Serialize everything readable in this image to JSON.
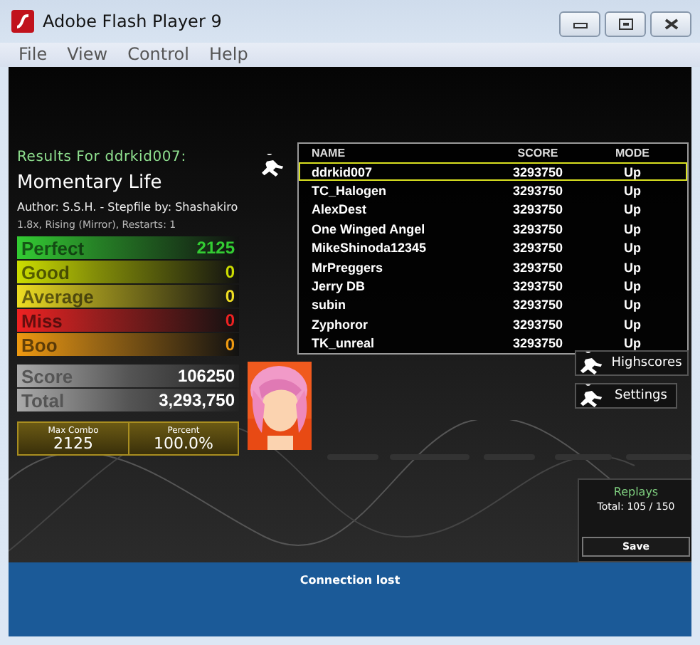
{
  "window": {
    "title": "Adobe Flash Player 9",
    "menu": [
      "File",
      "View",
      "Control",
      "Help"
    ]
  },
  "results": {
    "heading": "Results For ddrkid007:",
    "song": "Momentary Life",
    "credits": "Author: S.S.H.  -  Stepfile by: Shashakiro",
    "mods": "1.8x, Rising (Mirror), Restarts: 1",
    "judgements": [
      {
        "label": "Perfect",
        "value": "2125",
        "color": "#33cc33"
      },
      {
        "label": "Good",
        "value": "0",
        "color": "#ccdd00"
      },
      {
        "label": "Average",
        "value": "0",
        "color": "#eedd22"
      },
      {
        "label": "Miss",
        "value": "0",
        "color": "#ee2222"
      },
      {
        "label": "Boo",
        "value": "0",
        "color": "#ee9911"
      }
    ],
    "score": {
      "label": "Score",
      "value": "106250"
    },
    "total": {
      "label": "Total",
      "value": "3,293,750"
    },
    "max_combo": {
      "label": "Max Combo",
      "value": "2125"
    },
    "percent": {
      "label": "Percent",
      "value": "100.0%"
    }
  },
  "highscores": {
    "columns": [
      "NAME",
      "SCORE",
      "MODE"
    ],
    "rows": [
      {
        "name": "ddrkid007",
        "score": "3293750",
        "mode": "Up",
        "selected": true
      },
      {
        "name": "TC_Halogen",
        "score": "3293750",
        "mode": "Up",
        "selected": false
      },
      {
        "name": "AlexDest",
        "score": "3293750",
        "mode": "Up",
        "selected": false
      },
      {
        "name": "One Winged Angel",
        "score": "3293750",
        "mode": "Up",
        "selected": false
      },
      {
        "name": "MikeShinoda12345",
        "score": "3293750",
        "mode": "Up",
        "selected": false
      },
      {
        "name": "MrPreggers",
        "score": "3293750",
        "mode": "Up",
        "selected": false
      },
      {
        "name": "Jerry DB",
        "score": "3293750",
        "mode": "Up",
        "selected": false
      },
      {
        "name": "subin",
        "score": "3293750",
        "mode": "Up",
        "selected": false
      },
      {
        "name": "Zyphoror",
        "score": "3293750",
        "mode": "Up",
        "selected": false
      },
      {
        "name": "TK_unreal",
        "score": "3293750",
        "mode": "Up",
        "selected": false
      }
    ]
  },
  "buttons": [
    "Highscores",
    "Settings"
  ],
  "replays": {
    "title": "Replays",
    "total": "Total: 105 / 150",
    "button": "Save"
  },
  "status": "Connection lost"
}
